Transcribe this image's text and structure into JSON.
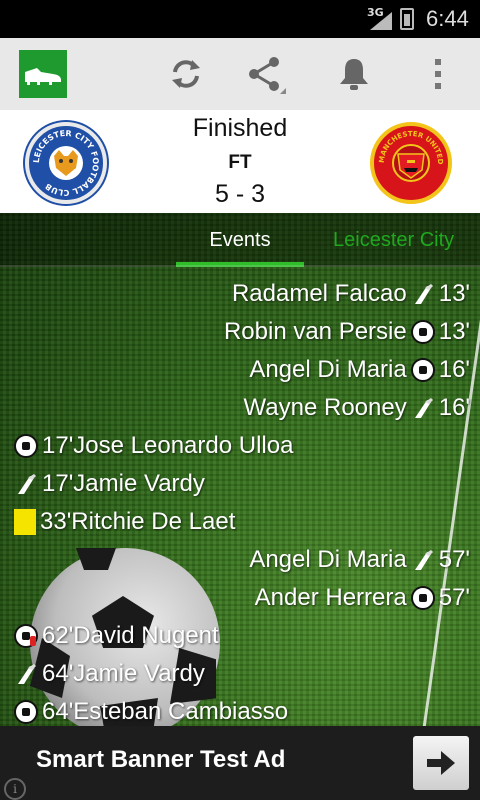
{
  "status_bar": {
    "network": "3G",
    "time": "6:44",
    "icons": [
      "signal-icon",
      "battery-icon"
    ]
  },
  "action_bar": {
    "app_icon": "boot-icon",
    "actions": [
      {
        "name": "refresh",
        "icon": "refresh-icon"
      },
      {
        "name": "share",
        "icon": "share-icon"
      },
      {
        "name": "notifications",
        "icon": "bell-icon"
      },
      {
        "name": "overflow-menu",
        "icon": "more-vert-icon"
      }
    ],
    "background": "#e8e8e8",
    "app_icon_color": "#1e9a2e"
  },
  "match": {
    "status": "Finished",
    "period": "FT",
    "score": "5 - 3",
    "home_crest": {
      "text": "LEICESTER CITY FOOTBALL CLUB",
      "color": "#1f4fa6"
    },
    "away_crest": {
      "text": "MANCHESTER UNITED",
      "color": "#d8141b"
    }
  },
  "tabs": [
    {
      "label": "Events",
      "selected": true
    },
    {
      "label": "Leicester City",
      "selected": false
    }
  ],
  "tab_indicator_color": "#2fbd2a",
  "events": [
    {
      "side": "right",
      "player": "Radamel Falcao",
      "type": "assist",
      "icon": "boot-icon",
      "minute": "13'"
    },
    {
      "side": "right",
      "player": "Robin van Persie",
      "type": "goal",
      "icon": "ball-icon",
      "minute": "13'"
    },
    {
      "side": "right",
      "player": "Angel Di Maria",
      "type": "goal",
      "icon": "ball-icon",
      "minute": "16'"
    },
    {
      "side": "right",
      "player": "Wayne Rooney",
      "type": "assist",
      "icon": "boot-icon",
      "minute": "16'"
    },
    {
      "side": "left",
      "player": "Jose Leonardo Ulloa",
      "type": "goal",
      "icon": "ball-icon",
      "minute": "17'"
    },
    {
      "side": "left",
      "player": "Jamie Vardy",
      "type": "assist",
      "icon": "boot-icon",
      "minute": "17'"
    },
    {
      "side": "left",
      "player": "Ritchie De Laet",
      "type": "yellow-card",
      "icon": "yellow-card-icon",
      "minute": "33'"
    },
    {
      "side": "right",
      "player": "Angel Di Maria",
      "type": "assist",
      "icon": "boot-icon",
      "minute": "57'"
    },
    {
      "side": "right",
      "player": "Ander Herrera",
      "type": "goal",
      "icon": "ball-icon",
      "minute": "57'"
    },
    {
      "side": "left",
      "player": "David Nugent",
      "type": "penalty-goal",
      "icon": "penalty-ball-icon",
      "minute": "62'"
    },
    {
      "side": "left",
      "player": "Jamie Vardy",
      "type": "assist",
      "icon": "boot-icon",
      "minute": "64'"
    },
    {
      "side": "left",
      "player": "Esteban Cambiasso",
      "type": "goal",
      "icon": "ball-icon",
      "minute": "64'"
    }
  ],
  "ad": {
    "text": "Smart Banner Test Ad",
    "arrow_icon": "arrow-right-icon",
    "info_icon": "info-icon",
    "info_glyph": "i"
  }
}
